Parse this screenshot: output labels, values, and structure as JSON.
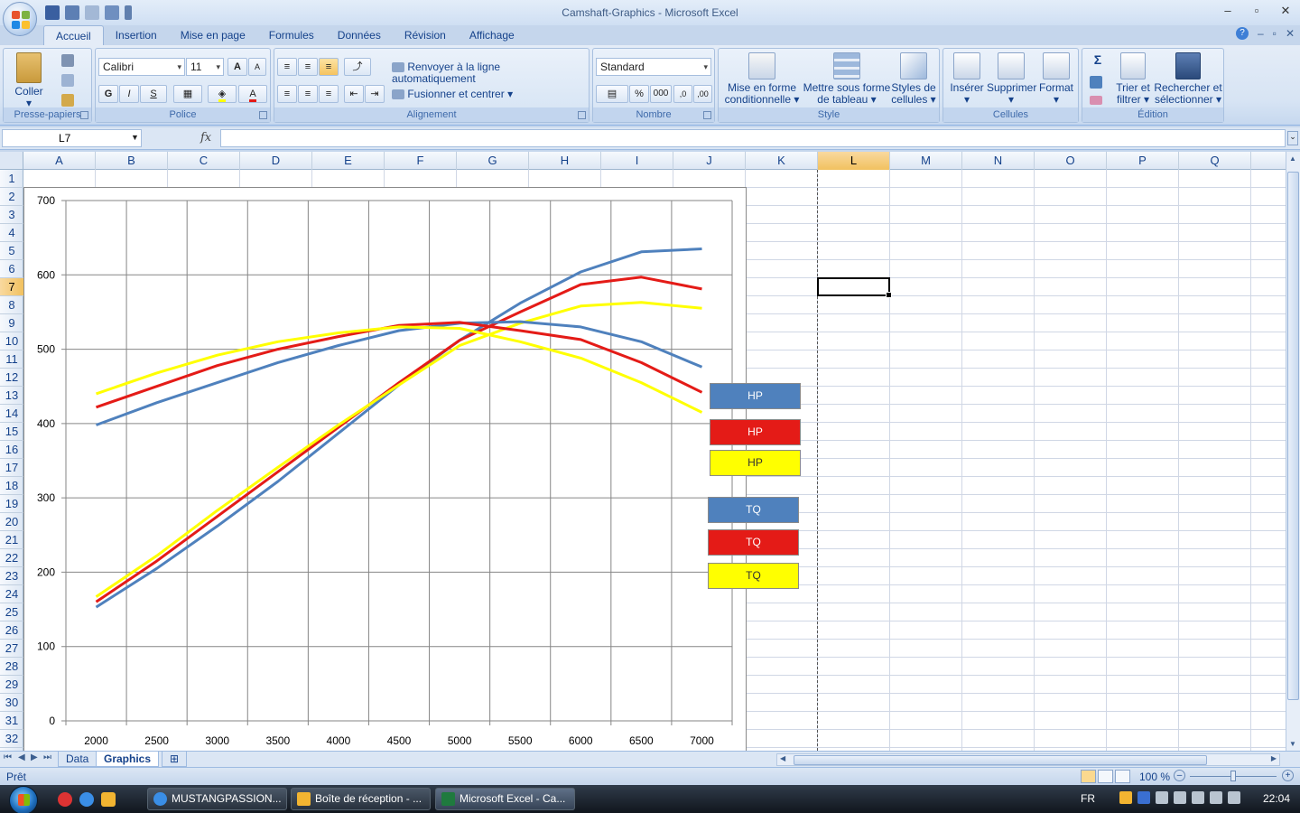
{
  "window": {
    "title": "Camshaft-Graphics - Microsoft Excel"
  },
  "ribbon": {
    "tabs": [
      "Accueil",
      "Insertion",
      "Mise en page",
      "Formules",
      "Données",
      "Révision",
      "Affichage"
    ],
    "active_tab": "Accueil",
    "clipboard": {
      "label": "Presse-papiers",
      "paste": "Coller"
    },
    "font": {
      "label": "Police",
      "name": "Calibri",
      "size": "11",
      "bold": "G",
      "italic": "I",
      "underline": "S",
      "color_a": "A"
    },
    "alignment": {
      "label": "Alignement",
      "wrap": "Renvoyer à la ligne automatiquement",
      "merge": "Fusionner et centrer"
    },
    "number": {
      "label": "Nombre",
      "format": "Standard",
      "percent": "%",
      "thousands": "000",
      "inc_dec": ",0",
      "dec_dec": ",00"
    },
    "style": {
      "label": "Style",
      "conditional_1": "Mise en forme",
      "conditional_2": "conditionnelle",
      "table_1": "Mettre sous forme",
      "table_2": "de tableau",
      "cell_styles_1": "Styles de",
      "cell_styles_2": "cellules"
    },
    "cells": {
      "label": "Cellules",
      "insert": "Insérer",
      "delete": "Supprimer",
      "format": "Format"
    },
    "editing": {
      "label": "Édition",
      "sigma": "Σ",
      "sort_1": "Trier et",
      "sort_2": "filtrer",
      "find_1": "Rechercher et",
      "find_2": "sélectionner"
    }
  },
  "formula_bar": {
    "name_box": "L7",
    "fx": "fx",
    "value": ""
  },
  "grid": {
    "columns": [
      "A",
      "B",
      "C",
      "D",
      "E",
      "F",
      "G",
      "H",
      "I",
      "J",
      "K",
      "L",
      "M",
      "N",
      "O",
      "P",
      "Q"
    ],
    "rows": [
      "1",
      "2",
      "3",
      "4",
      "5",
      "6",
      "7",
      "8",
      "9",
      "10",
      "11",
      "12",
      "13",
      "14",
      "15",
      "16",
      "17",
      "18",
      "19",
      "20",
      "21",
      "22",
      "23",
      "24",
      "25",
      "26",
      "27",
      "28",
      "29",
      "30",
      "31",
      "32"
    ],
    "selected_column": "L",
    "selected_row": "7"
  },
  "chart_data": {
    "type": "line",
    "title": "",
    "xlabel": "",
    "ylabel": "",
    "x": [
      2000,
      2500,
      3000,
      3500,
      4000,
      4500,
      5000,
      5500,
      6000,
      6500,
      7000
    ],
    "ylim": [
      0,
      700
    ],
    "yticks": [
      0,
      100,
      200,
      300,
      400,
      500,
      600,
      700
    ],
    "grid": true,
    "legend_position": "right",
    "series": [
      {
        "name": "HP",
        "color": "#4f81bd",
        "values": [
          153,
          205,
          262,
          322,
          387,
          452,
          512,
          562,
          604,
          631,
          635
        ]
      },
      {
        "name": "HP",
        "color": "#e41b17",
        "values": [
          160,
          215,
          275,
          335,
          395,
          455,
          512,
          550,
          587,
          597,
          581
        ]
      },
      {
        "name": "HP",
        "color": "#ffff00",
        "values": [
          167,
          222,
          283,
          341,
          398,
          452,
          505,
          535,
          558,
          563,
          555
        ]
      },
      {
        "name": "TQ",
        "color": "#4f81bd",
        "values": [
          398,
          428,
          455,
          482,
          505,
          525,
          535,
          537,
          530,
          510,
          476
        ]
      },
      {
        "name": "TQ",
        "color": "#e41b17",
        "values": [
          422,
          450,
          478,
          500,
          517,
          532,
          536,
          525,
          513,
          482,
          442
        ]
      },
      {
        "name": "TQ",
        "color": "#ffff00",
        "values": [
          440,
          468,
          492,
          510,
          522,
          530,
          528,
          510,
          488,
          455,
          415
        ]
      }
    ]
  },
  "sheets": {
    "tabs": [
      "Data",
      "Graphics"
    ],
    "active": "Graphics"
  },
  "status": {
    "ready": "Prêt",
    "zoom": "100 %"
  },
  "taskbar": {
    "tasks": [
      "MUSTANGPASSION...",
      "Boîte de réception - ...",
      "Microsoft Excel - Ca..."
    ],
    "language": "FR",
    "clock": "22:04"
  },
  "colors": {
    "accent": "#15428b",
    "selection": "#f1c15f"
  }
}
